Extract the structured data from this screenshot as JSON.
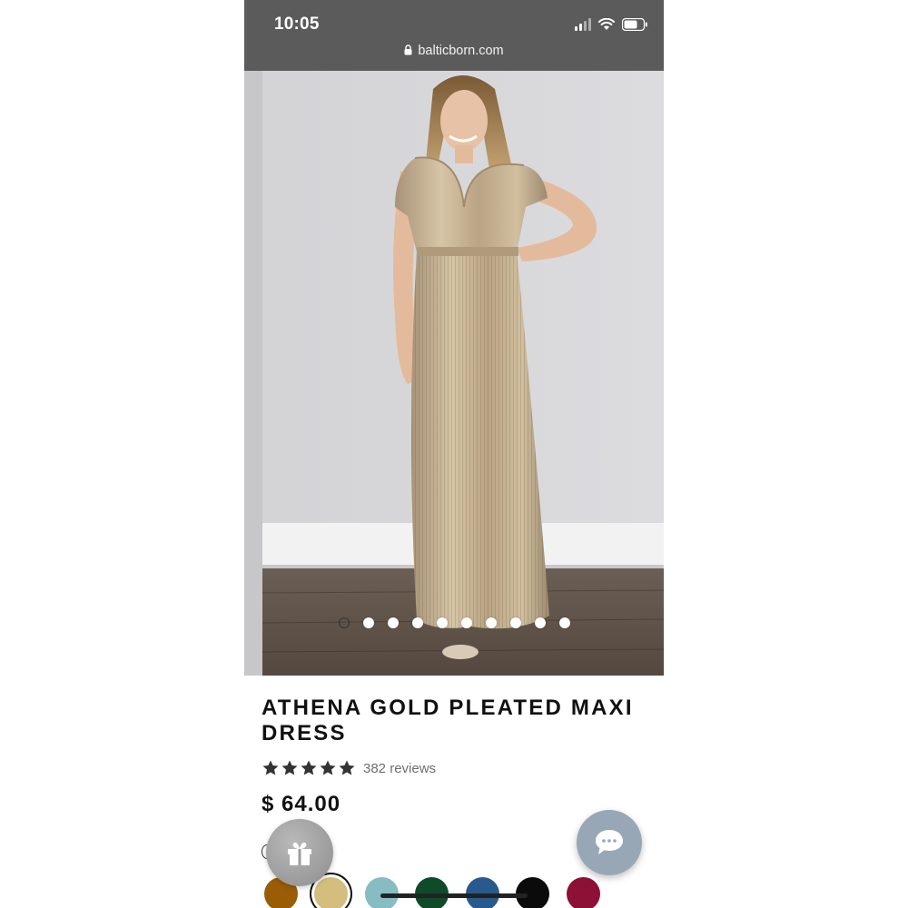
{
  "status_bar": {
    "time": "10:05",
    "url": "balticborn.com",
    "icons": [
      "signal-icon",
      "wifi-icon",
      "battery-icon"
    ]
  },
  "gallery": {
    "image_count": 10,
    "active_index": 0,
    "image_alt": "product photo"
  },
  "product": {
    "title": "ATHENA GOLD PLEATED MAXI DRESS",
    "rating": 5,
    "reviews": "382 reviews",
    "price": "$ 64.00"
  },
  "swatches": [
    {
      "name": "amber",
      "color": "#9a5d06",
      "selected": false
    },
    {
      "name": "gold",
      "color": "#d4bd7d",
      "selected": true
    },
    {
      "name": "teal",
      "color": "#86bcc2",
      "selected": false
    },
    {
      "name": "emerald",
      "color": "#0f4b2b",
      "selected": false
    },
    {
      "name": "blue",
      "color": "#2a5a8d",
      "selected": false
    },
    {
      "name": "black",
      "color": "#0b0b0b",
      "selected": false
    },
    {
      "name": "burgundy",
      "color": "#8d1037",
      "selected": false
    }
  ],
  "colors": {
    "status_bar": "#5b5b5b",
    "chat_button": "#98a7b5",
    "gift_button": "#a3a3a3"
  }
}
